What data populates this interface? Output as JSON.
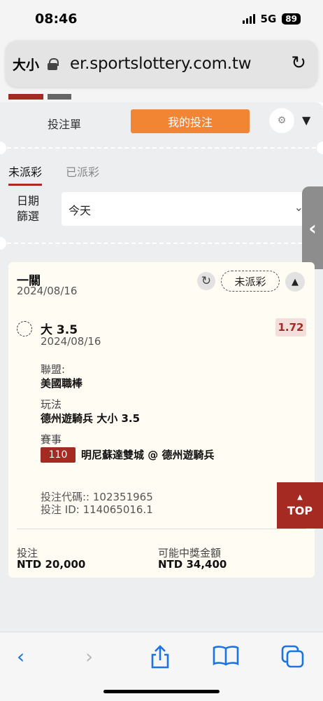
{
  "status_bar": {
    "time": "08:46",
    "network": "5G",
    "battery": "89"
  },
  "url_bar": {
    "aa_label": "大小",
    "url": "er.sportslottery.com.tw"
  },
  "panel": {
    "tab_betslip": "投注單",
    "tab_my_bets": "我的投注",
    "subtab_unsettled": "未派彩",
    "subtab_settled": "已派彩",
    "date_filter_label": "日期篩選",
    "date_filter_value": "今天"
  },
  "bet_card": {
    "title": "一關",
    "date": "2024/08/16",
    "status": "未派彩",
    "pick": "大 3.5",
    "pick_date": "2024/08/16",
    "odds": "1.72",
    "league_label": "聯盟:",
    "league_value": "美國職棒",
    "play_label": "玩法",
    "play_value": "德州遊騎兵 大小 3.5",
    "event_label": "賽事",
    "event_number": "110",
    "event_name": "明尼蘇達雙城 @ 德州遊騎兵",
    "bet_code": "投注代碼:: 102351965",
    "bet_id": "投注 ID: 114065016.1",
    "stake_label": "投注",
    "stake_value": "NTD 20,000",
    "payout_label": "可能中獎金額",
    "payout_value": "NTD 34,400"
  },
  "top_button": {
    "label": "TOP"
  },
  "icons": {
    "refresh": "refresh-icon",
    "gear": "gear-icon",
    "collapse": "chevron-up-icon",
    "share": "share-icon",
    "bookmarks": "bookmarks-icon",
    "tabs": "tabs-icon"
  },
  "colors": {
    "accent_orange": "#f28534",
    "brand_red": "#a52a22",
    "link_blue": "#1a73e8"
  }
}
